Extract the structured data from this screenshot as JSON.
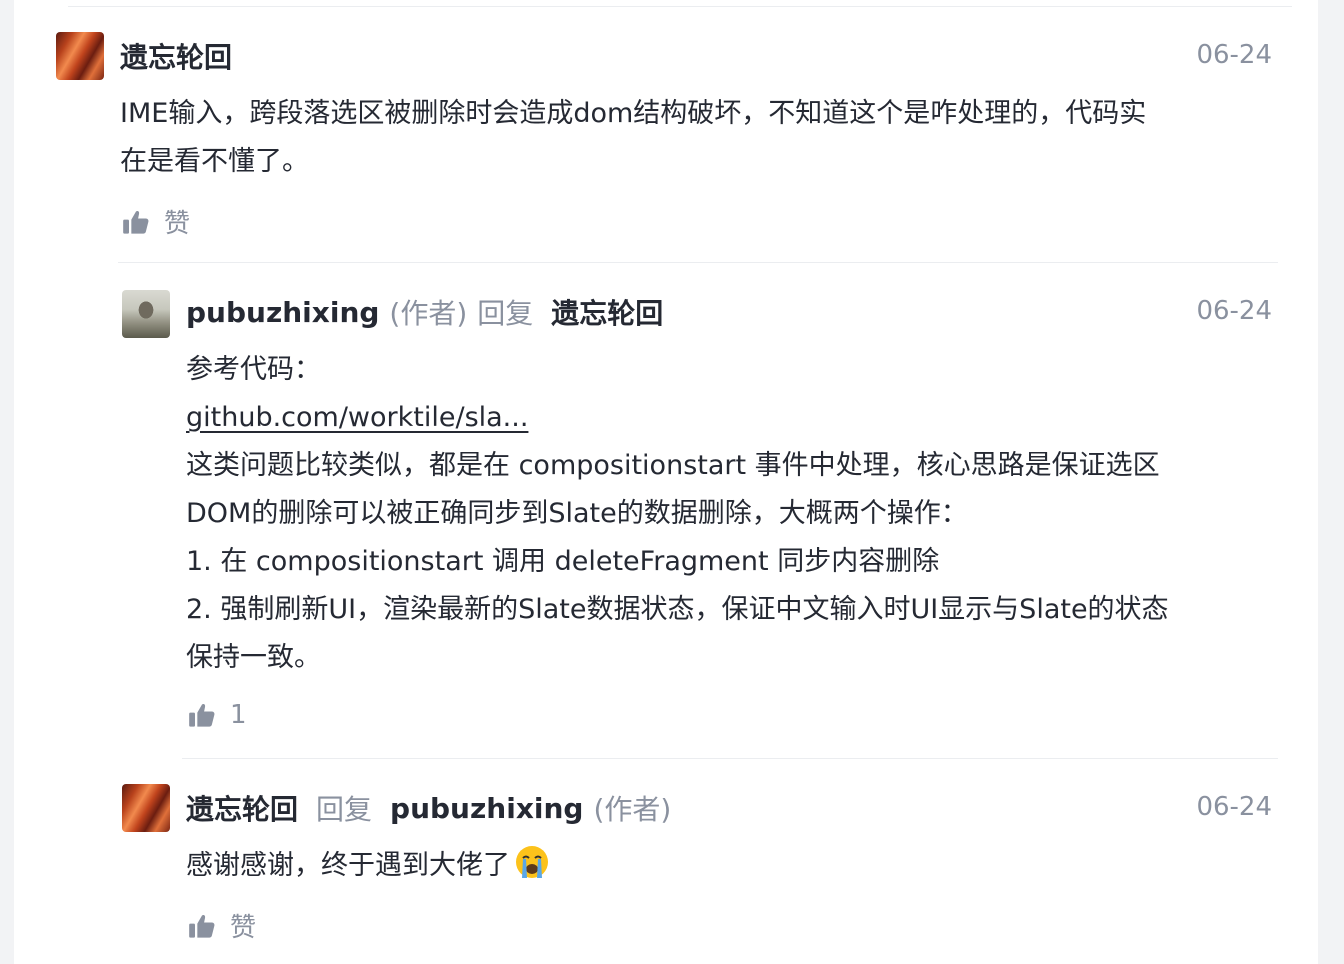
{
  "comments": [
    {
      "username": "遗忘轮回",
      "date": "06-24",
      "content_lines": [
        "IME输入，跨段落选区被删除时会造成dom结构破坏，不知道这个是咋处理的，代码实",
        "在是看不懂了。"
      ],
      "like_label": "赞",
      "avatar_icon": "canyon-avatar"
    },
    {
      "username": "pubuzhixing",
      "author_tag": "(作者)",
      "reply_word": "回复",
      "reply_target": "遗忘轮回",
      "date": "06-24",
      "lines": {
        "intro": "参考代码：",
        "link": "github.com/worktile/sla...",
        "l1": "这类问题比较类似，都是在 compositionstart 事件中处理，核心思路是保证选区",
        "l2": "DOM的删除可以被正确同步到Slate的数据删除，大概两个操作：",
        "l3": "1. 在 compositionstart 调用 deleteFragment 同步内容删除",
        "l4": "2. 强制刷新UI，渲染最新的Slate数据状态，保证中文输入时UI显示与Slate的状态",
        "l5": "保持一致。"
      },
      "like_count": "1",
      "avatar_icon": "person-avatar"
    },
    {
      "username": "遗忘轮回",
      "reply_word": "回复",
      "reply_target": "pubuzhixing",
      "reply_target_tag": "(作者)",
      "date": "06-24",
      "content": "感谢感谢，终于遇到大佬了",
      "emoji": "crying-face-emoji",
      "like_label": "赞",
      "avatar_icon": "canyon-avatar"
    }
  ],
  "colors": {
    "text": "#252933",
    "muted": "#8a919f",
    "divider": "#ebedf0",
    "background": "#ffffff"
  }
}
